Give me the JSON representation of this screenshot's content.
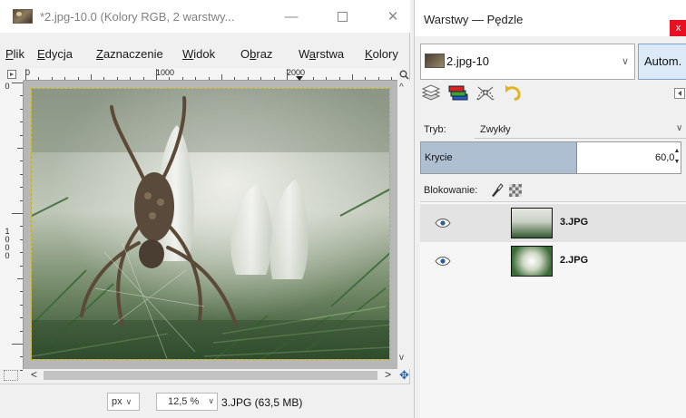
{
  "image_window": {
    "title": "*2.jpg-10.0 (Kolory RGB, 2 warstwy...",
    "controls": {
      "minimize": "—",
      "maximize": "",
      "close": "✕"
    },
    "menu": [
      {
        "label": "Plik",
        "accel": "P"
      },
      {
        "label": "Edycja",
        "accel": "E"
      },
      {
        "label": "Zaznaczenie",
        "accel": "Z"
      },
      {
        "label": "Widok",
        "accel": "W"
      },
      {
        "label": "Obraz",
        "accel": "b"
      },
      {
        "label": "Warstwa",
        "accel": "a"
      },
      {
        "label": "Kolory",
        "accel": "K"
      }
    ],
    "ruler_top_labels": [
      "0",
      "1000",
      "2000"
    ],
    "ruler_left_label": "1000",
    "ruler_left_top": "0",
    "statusbar": {
      "unit": "px",
      "zoom": "12,5 %",
      "info": "3.JPG (63,5 MB)"
    }
  },
  "dock": {
    "title": "Warstwy — Pędzle",
    "close": "x",
    "image_selector": "2.jpg-10",
    "auto_button": "Autom.",
    "tabs": [
      "layers-icon",
      "channels-icon",
      "paths-icon",
      "undo-history-icon"
    ],
    "mode_label": "Tryb:",
    "mode_value": "Zwykły",
    "opacity_label": "Krycie",
    "opacity_value": "60,0",
    "opacity_fraction": 0.6,
    "lock_label": "Blokowanie:",
    "layers": [
      {
        "name": "3.JPG",
        "visible": true,
        "selected": true
      },
      {
        "name": "2.JPG",
        "visible": true,
        "selected": false
      }
    ]
  },
  "colors": {
    "selection_blue": "#dce9f7",
    "opacity_fill": "#aebfd2",
    "close_red": "#e81123",
    "nav_blue": "#1f62b8"
  }
}
